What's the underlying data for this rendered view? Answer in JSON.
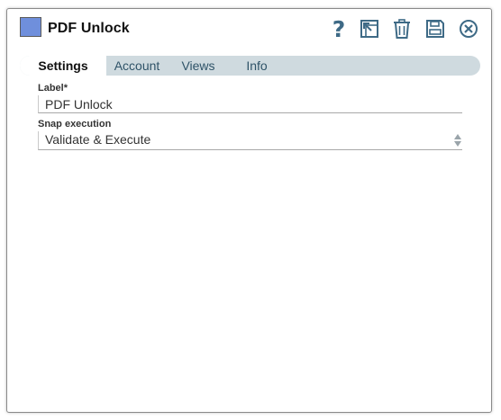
{
  "window": {
    "title": "PDF Unlock",
    "swatch_color": "#6f8fdc"
  },
  "toolbar": {
    "help_glyph": "?",
    "icons": [
      "help-icon",
      "export-icon",
      "trash-icon",
      "save-icon",
      "close-circle-icon"
    ],
    "icon_color": "#3e6a86"
  },
  "tabs": [
    {
      "label": "Settings",
      "active": true
    },
    {
      "label": "Account",
      "active": false
    },
    {
      "label": "Views",
      "active": false
    },
    {
      "label": "Info",
      "active": false
    }
  ],
  "form": {
    "label_field": {
      "label": "Label*",
      "value": "PDF Unlock"
    },
    "snap_execution": {
      "label": "Snap execution",
      "value": "Validate & Execute"
    }
  }
}
